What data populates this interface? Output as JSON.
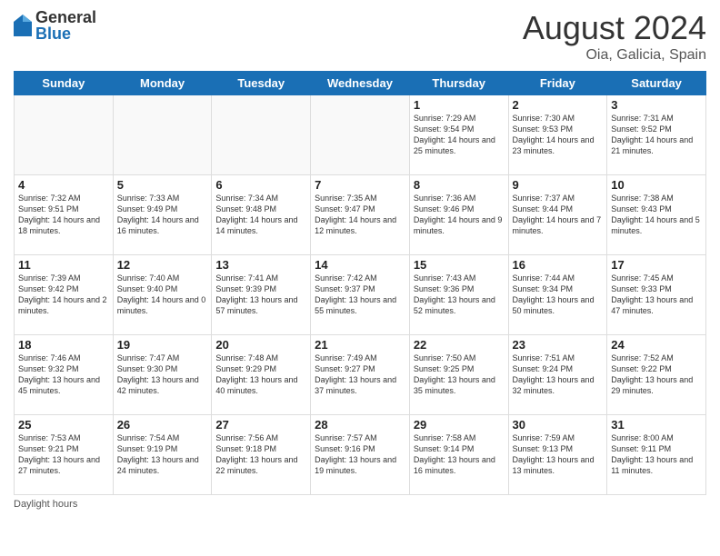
{
  "logo": {
    "general": "General",
    "blue": "Blue"
  },
  "title": "August 2024",
  "subtitle": "Oia, Galicia, Spain",
  "headers": [
    "Sunday",
    "Monday",
    "Tuesday",
    "Wednesday",
    "Thursday",
    "Friday",
    "Saturday"
  ],
  "weeks": [
    [
      {
        "day": "",
        "info": ""
      },
      {
        "day": "",
        "info": ""
      },
      {
        "day": "",
        "info": ""
      },
      {
        "day": "",
        "info": ""
      },
      {
        "day": "1",
        "info": "Sunrise: 7:29 AM\nSunset: 9:54 PM\nDaylight: 14 hours\nand 25 minutes."
      },
      {
        "day": "2",
        "info": "Sunrise: 7:30 AM\nSunset: 9:53 PM\nDaylight: 14 hours\nand 23 minutes."
      },
      {
        "day": "3",
        "info": "Sunrise: 7:31 AM\nSunset: 9:52 PM\nDaylight: 14 hours\nand 21 minutes."
      }
    ],
    [
      {
        "day": "4",
        "info": "Sunrise: 7:32 AM\nSunset: 9:51 PM\nDaylight: 14 hours\nand 18 minutes."
      },
      {
        "day": "5",
        "info": "Sunrise: 7:33 AM\nSunset: 9:49 PM\nDaylight: 14 hours\nand 16 minutes."
      },
      {
        "day": "6",
        "info": "Sunrise: 7:34 AM\nSunset: 9:48 PM\nDaylight: 14 hours\nand 14 minutes."
      },
      {
        "day": "7",
        "info": "Sunrise: 7:35 AM\nSunset: 9:47 PM\nDaylight: 14 hours\nand 12 minutes."
      },
      {
        "day": "8",
        "info": "Sunrise: 7:36 AM\nSunset: 9:46 PM\nDaylight: 14 hours\nand 9 minutes."
      },
      {
        "day": "9",
        "info": "Sunrise: 7:37 AM\nSunset: 9:44 PM\nDaylight: 14 hours\nand 7 minutes."
      },
      {
        "day": "10",
        "info": "Sunrise: 7:38 AM\nSunset: 9:43 PM\nDaylight: 14 hours\nand 5 minutes."
      }
    ],
    [
      {
        "day": "11",
        "info": "Sunrise: 7:39 AM\nSunset: 9:42 PM\nDaylight: 14 hours\nand 2 minutes."
      },
      {
        "day": "12",
        "info": "Sunrise: 7:40 AM\nSunset: 9:40 PM\nDaylight: 14 hours\nand 0 minutes."
      },
      {
        "day": "13",
        "info": "Sunrise: 7:41 AM\nSunset: 9:39 PM\nDaylight: 13 hours\nand 57 minutes."
      },
      {
        "day": "14",
        "info": "Sunrise: 7:42 AM\nSunset: 9:37 PM\nDaylight: 13 hours\nand 55 minutes."
      },
      {
        "day": "15",
        "info": "Sunrise: 7:43 AM\nSunset: 9:36 PM\nDaylight: 13 hours\nand 52 minutes."
      },
      {
        "day": "16",
        "info": "Sunrise: 7:44 AM\nSunset: 9:34 PM\nDaylight: 13 hours\nand 50 minutes."
      },
      {
        "day": "17",
        "info": "Sunrise: 7:45 AM\nSunset: 9:33 PM\nDaylight: 13 hours\nand 47 minutes."
      }
    ],
    [
      {
        "day": "18",
        "info": "Sunrise: 7:46 AM\nSunset: 9:32 PM\nDaylight: 13 hours\nand 45 minutes."
      },
      {
        "day": "19",
        "info": "Sunrise: 7:47 AM\nSunset: 9:30 PM\nDaylight: 13 hours\nand 42 minutes."
      },
      {
        "day": "20",
        "info": "Sunrise: 7:48 AM\nSunset: 9:29 PM\nDaylight: 13 hours\nand 40 minutes."
      },
      {
        "day": "21",
        "info": "Sunrise: 7:49 AM\nSunset: 9:27 PM\nDaylight: 13 hours\nand 37 minutes."
      },
      {
        "day": "22",
        "info": "Sunrise: 7:50 AM\nSunset: 9:25 PM\nDaylight: 13 hours\nand 35 minutes."
      },
      {
        "day": "23",
        "info": "Sunrise: 7:51 AM\nSunset: 9:24 PM\nDaylight: 13 hours\nand 32 minutes."
      },
      {
        "day": "24",
        "info": "Sunrise: 7:52 AM\nSunset: 9:22 PM\nDaylight: 13 hours\nand 29 minutes."
      }
    ],
    [
      {
        "day": "25",
        "info": "Sunrise: 7:53 AM\nSunset: 9:21 PM\nDaylight: 13 hours\nand 27 minutes."
      },
      {
        "day": "26",
        "info": "Sunrise: 7:54 AM\nSunset: 9:19 PM\nDaylight: 13 hours\nand 24 minutes."
      },
      {
        "day": "27",
        "info": "Sunrise: 7:56 AM\nSunset: 9:18 PM\nDaylight: 13 hours\nand 22 minutes."
      },
      {
        "day": "28",
        "info": "Sunrise: 7:57 AM\nSunset: 9:16 PM\nDaylight: 13 hours\nand 19 minutes."
      },
      {
        "day": "29",
        "info": "Sunrise: 7:58 AM\nSunset: 9:14 PM\nDaylight: 13 hours\nand 16 minutes."
      },
      {
        "day": "30",
        "info": "Sunrise: 7:59 AM\nSunset: 9:13 PM\nDaylight: 13 hours\nand 13 minutes."
      },
      {
        "day": "31",
        "info": "Sunrise: 8:00 AM\nSunset: 9:11 PM\nDaylight: 13 hours\nand 11 minutes."
      }
    ]
  ],
  "footer": "Daylight hours"
}
